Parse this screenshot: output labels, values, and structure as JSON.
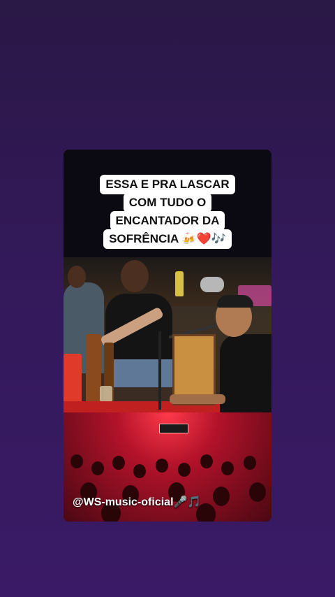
{
  "caption": {
    "lines": [
      "ESSA E PRA LASCAR",
      "COM TUDO O",
      "ENCANTADOR DA",
      "SOFRÊNCIA 🍻❤️🎶"
    ]
  },
  "handle": "@WS-music-oficial🎤🎵"
}
